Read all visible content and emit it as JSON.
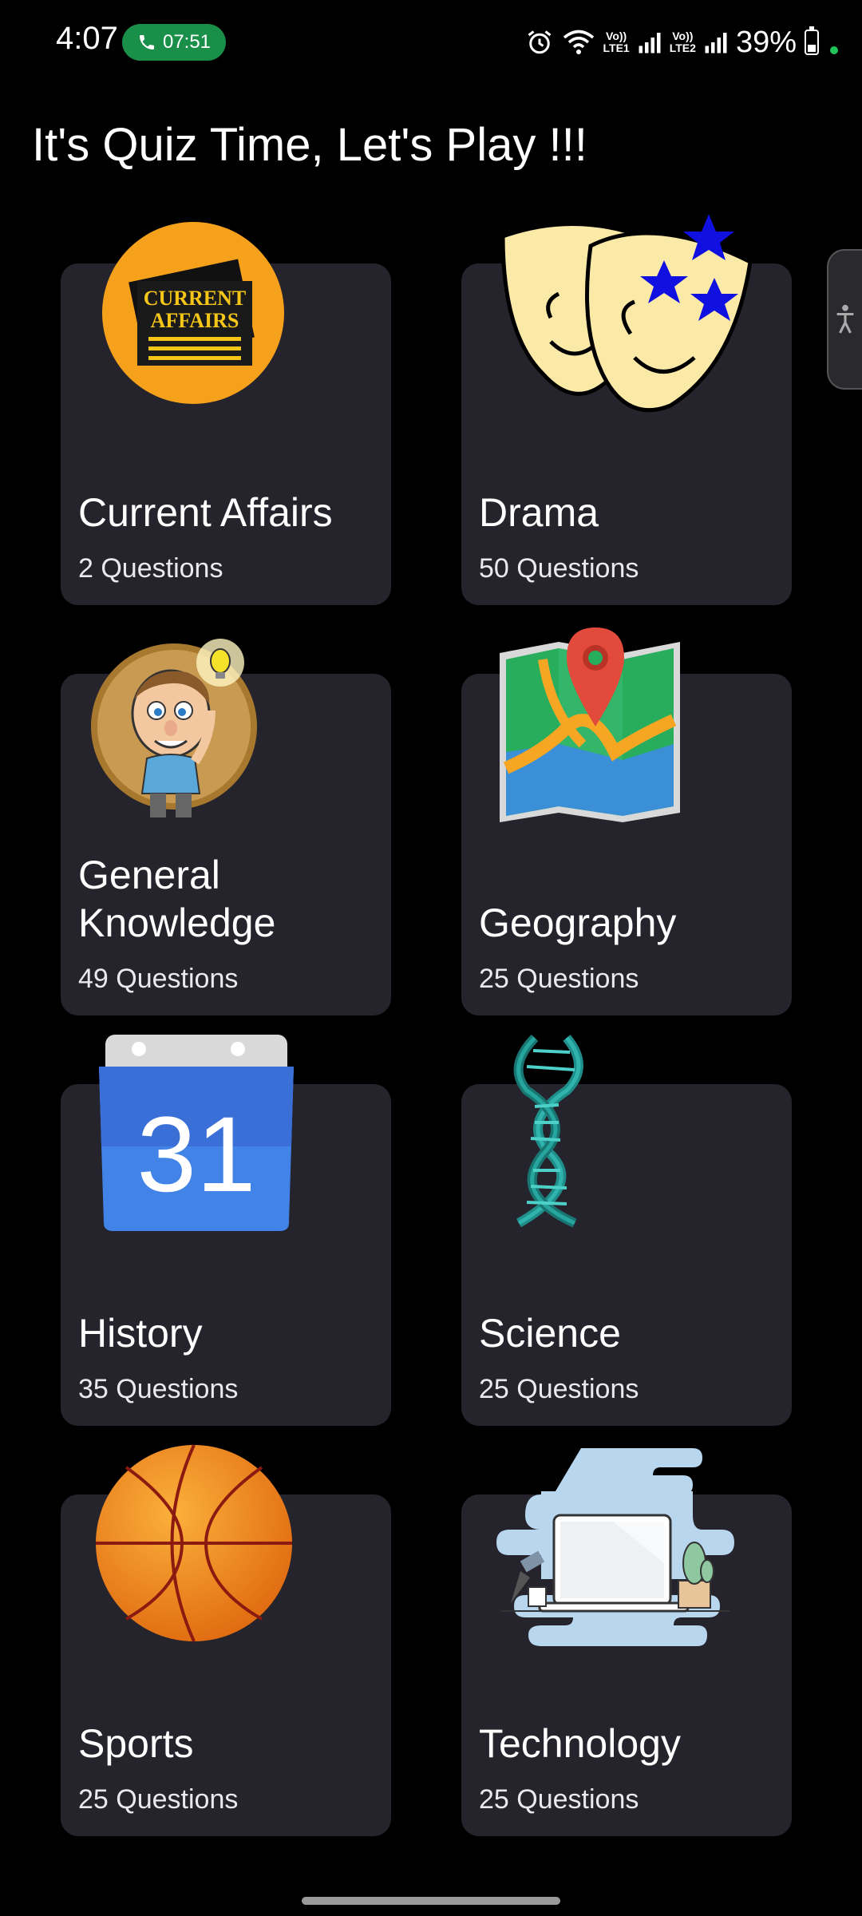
{
  "status_bar": {
    "time": "4:07",
    "call_duration": "07:51",
    "net1": [
      "Vo))",
      "LTE1"
    ],
    "net2": [
      "Vo))",
      "LTE2"
    ],
    "battery_percent": "39%",
    "battery_level": 0.39
  },
  "page": {
    "title": "It's Quiz Time, Let's Play !!!"
  },
  "categories": [
    {
      "name": "Current Affairs",
      "count": "2 Questions",
      "icon": "newspaper-icon",
      "badge_text": [
        "CURRENT",
        "AFFAIRS"
      ]
    },
    {
      "name": "Drama",
      "count": "50 Questions",
      "icon": "theater-masks-icon"
    },
    {
      "name": "General Knowledge",
      "count": "49 Questions",
      "icon": "thinking-man-icon"
    },
    {
      "name": "Geography",
      "count": "25 Questions",
      "icon": "map-icon"
    },
    {
      "name": "History",
      "count": "35 Questions",
      "icon": "calendar-icon",
      "badge_text": [
        "31"
      ]
    },
    {
      "name": "Science",
      "count": "25 Questions",
      "icon": "dna-icon"
    },
    {
      "name": "Sports",
      "count": "25 Questions",
      "icon": "basketball-icon"
    },
    {
      "name": "Technology",
      "count": "25 Questions",
      "icon": "laptop-desk-icon"
    }
  ],
  "colors": {
    "background": "#000000",
    "card": "#25232c",
    "call_pill": "#1a8f4a"
  }
}
